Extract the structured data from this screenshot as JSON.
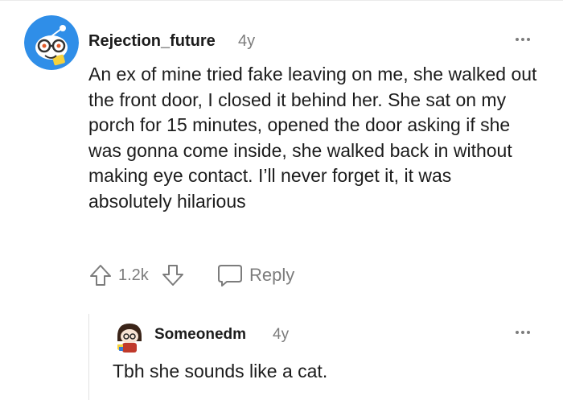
{
  "comment": {
    "username": "Rejection_future",
    "time": "4y",
    "body": "An ex of mine tried fake leaving on me, she walked out the front door, I closed it behind her. She sat on my porch for 15 minutes, opened the door asking if she was gonna come inside, she walked back in without making eye contact. I’ll never forget it, it was absolutely hilarious",
    "upvote_icon": "upvote-arrow-icon",
    "score": "1.2k",
    "downvote_icon": "downvote-arrow-icon",
    "reply_icon": "speech-bubble-icon",
    "reply_label": "Reply",
    "more_icon": "more-dots-icon"
  },
  "reply": {
    "username": "Someonedm",
    "time": "4y",
    "body": "Tbh she sounds like a cat.",
    "more_icon": "more-dots-icon"
  },
  "colors": {
    "text": "#1c1c1c",
    "meta": "#7c7c7c",
    "avatar_blue": "#1e88e5",
    "thread_line": "#e2e2e2"
  }
}
